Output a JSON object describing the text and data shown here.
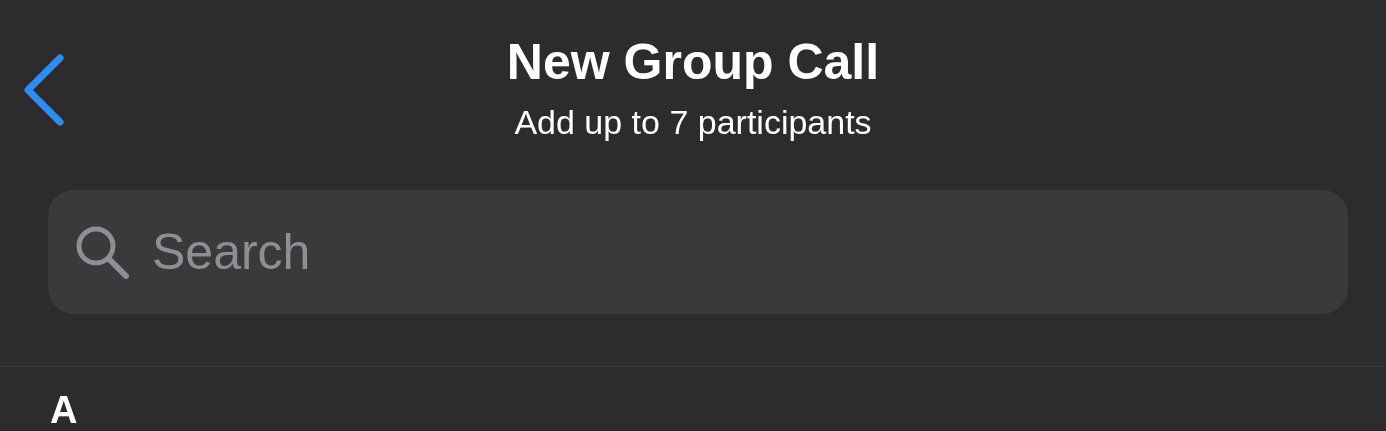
{
  "header": {
    "title": "New Group Call",
    "subtitle": "Add up to 7 participants"
  },
  "search": {
    "placeholder": "Search"
  },
  "sections": [
    {
      "letter": "A"
    }
  ]
}
